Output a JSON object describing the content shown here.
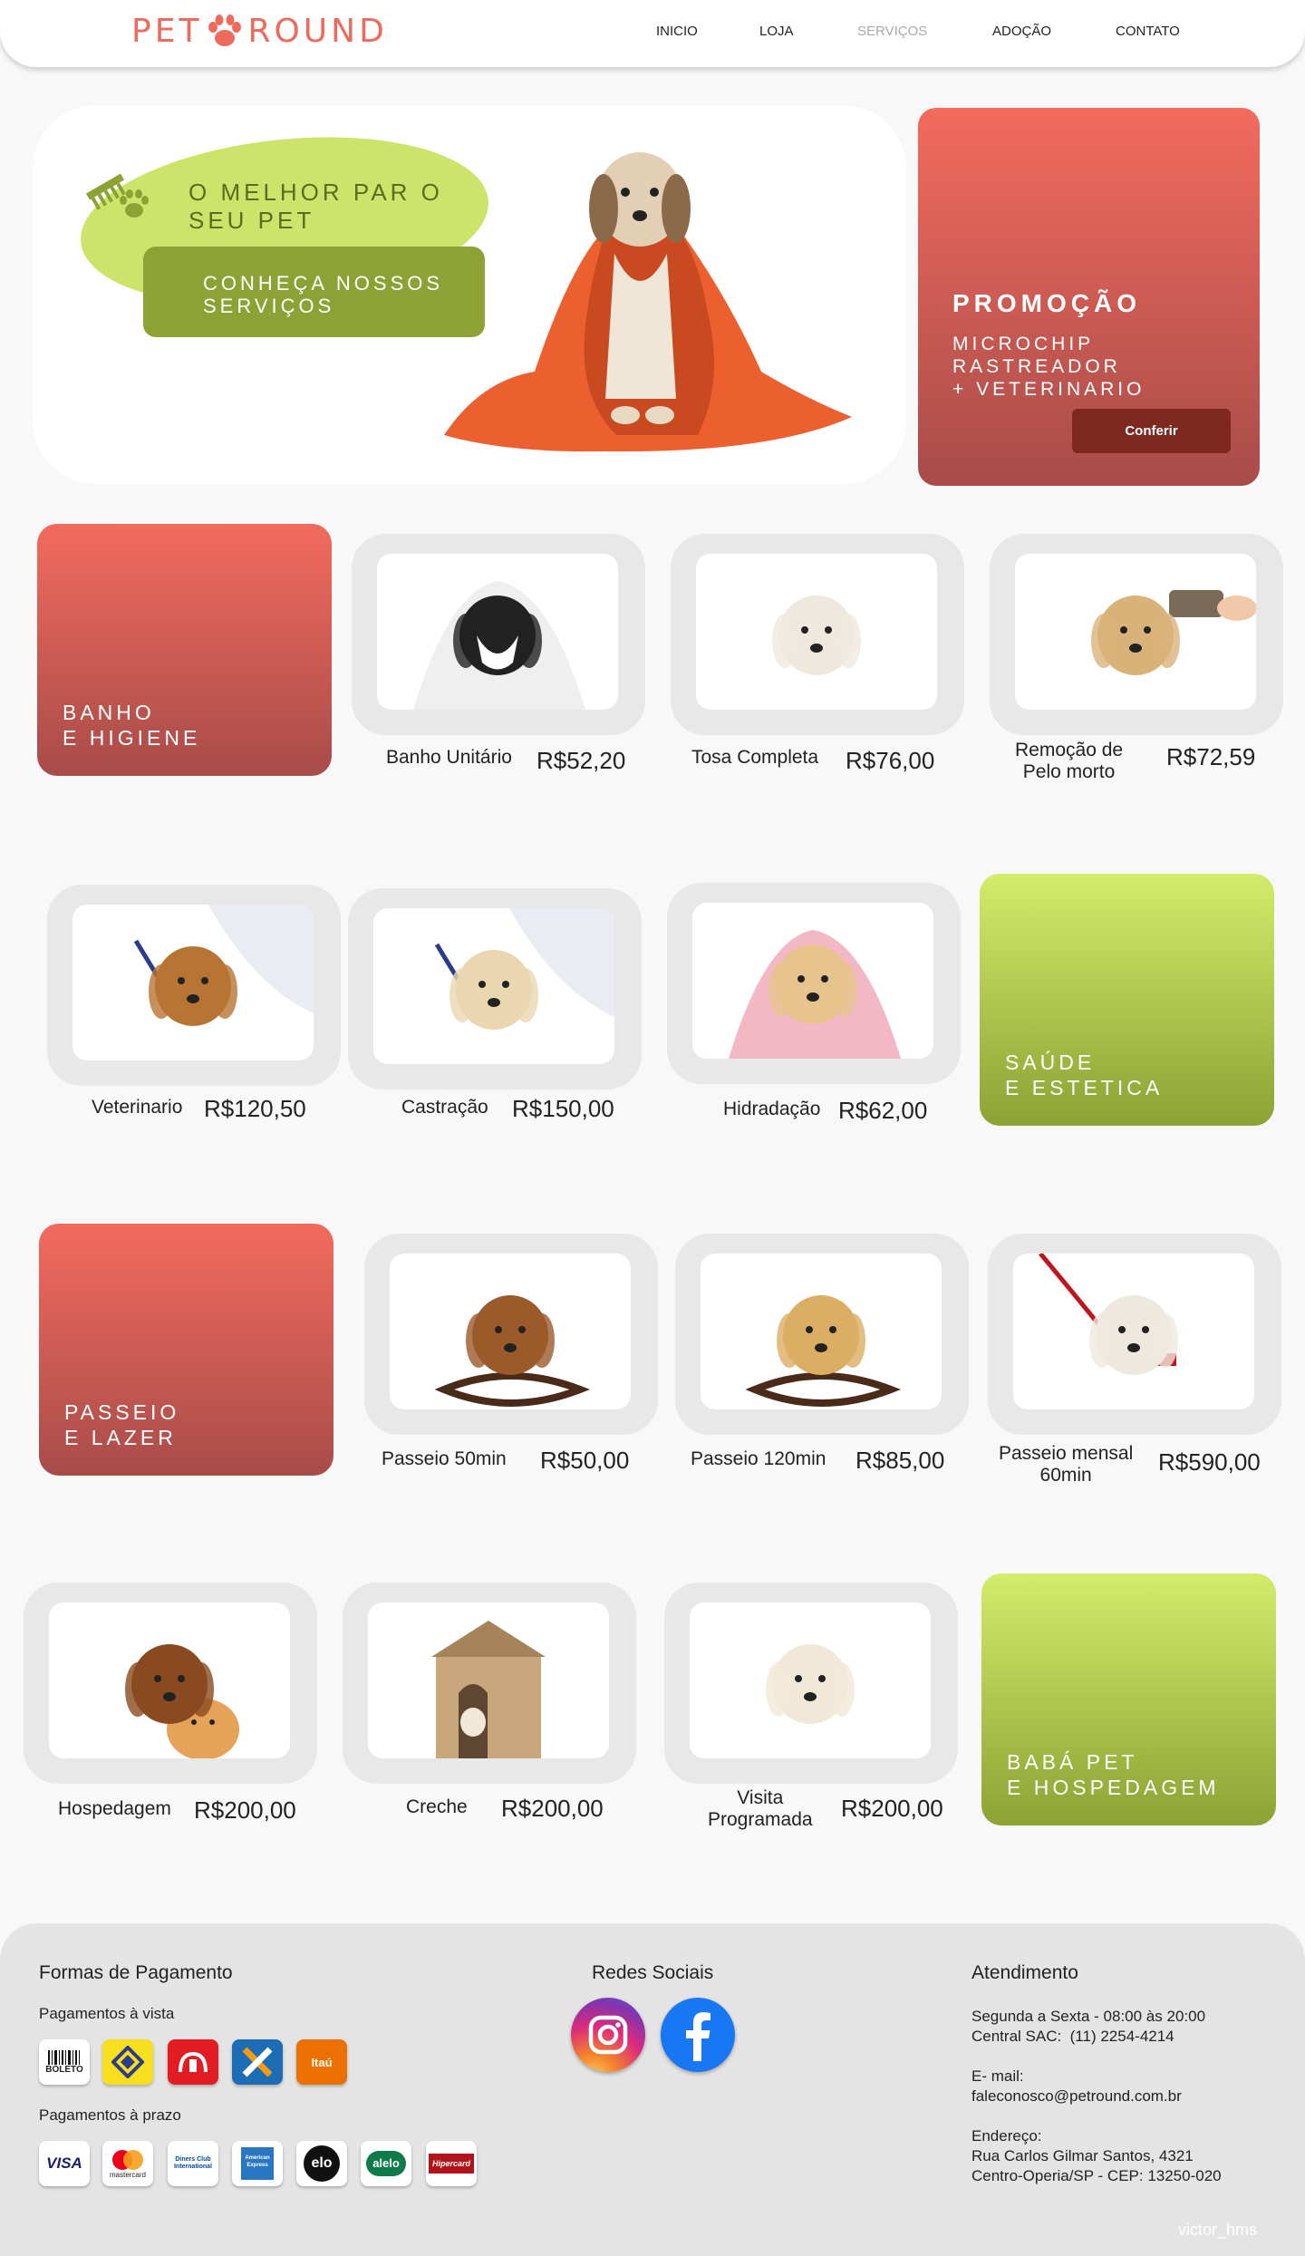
{
  "brand": {
    "left": "PET",
    "right": "ROUND"
  },
  "nav": [
    {
      "label": "INICIO",
      "active": false
    },
    {
      "label": "LOJA",
      "active": false
    },
    {
      "label": "SERVIÇOS",
      "active": true
    },
    {
      "label": "ADOÇÃO",
      "active": false
    },
    {
      "label": "CONTATO",
      "active": false
    }
  ],
  "hero": {
    "title_line1": "O MELHOR PAR O",
    "title_line2": "SEU PET",
    "button_line1": "CONHEÇA NOSSOS",
    "button_line2": "SERVIÇOS"
  },
  "promo": {
    "title": "PROMOÇÃO",
    "line1": "MICROCHIP",
    "line2": "RASTREADOR",
    "line3": "+ VETERINARIO",
    "button": "Conferir"
  },
  "categories": [
    {
      "line1": "BANHO",
      "line2": "E HIGIENE",
      "color": "red"
    },
    {
      "line1": "SAÚDE",
      "line2": "E ESTETICA",
      "color": "green"
    },
    {
      "line1": "PASSEIO",
      "line2": "E LAZER",
      "color": "red"
    },
    {
      "line1": "BABÁ PET",
      "line2": "E HOSPEDAGEM",
      "color": "green"
    }
  ],
  "services": [
    {
      "name1": "Banho Unitário",
      "name2": "",
      "price": "R$52,20",
      "image": "dog-in-towel"
    },
    {
      "name1": "Tosa Completa",
      "name2": "",
      "price": "R$76,00",
      "image": "groomed-white-dog"
    },
    {
      "name1": "Remoção de",
      "name2": "Pelo morto",
      "price": "R$72,59",
      "image": "dog-being-brushed"
    },
    {
      "name1": "Veterinario",
      "name2": "",
      "price": "R$120,50",
      "image": "vet-with-beagle"
    },
    {
      "name1": "Castração",
      "name2": "",
      "price": "R$150,00",
      "image": "vet-with-labrador"
    },
    {
      "name1": "Hidradação",
      "name2": "",
      "price": "R$62,00",
      "image": "chihuahua-in-towel"
    },
    {
      "name1": "Passeio 50min",
      "name2": "",
      "price": "R$50,00",
      "image": "dog-holding-leash"
    },
    {
      "name1": "Passeio 120min",
      "name2": "",
      "price": "R$85,00",
      "image": "labrador-with-leash"
    },
    {
      "name1": "Passeio mensal",
      "name2": "60min",
      "price": "R$590,00",
      "image": "bulldog-in-harness"
    },
    {
      "name1": "Hospedagem",
      "name2": "",
      "price": "R$200,00",
      "image": "dog-and-cat"
    },
    {
      "name1": "Creche",
      "name2": "",
      "price": "R$200,00",
      "image": "dog-house"
    },
    {
      "name1": "Visita",
      "name2": "Programada",
      "price": "R$200,00",
      "image": "lying-labrador"
    }
  ],
  "footer": {
    "payments_title": "Formas de Pagamento",
    "cash_title": "Pagamentos à vista",
    "cash_methods": [
      "BOLETO",
      "Banco do Brasil",
      "Bradesco",
      "Caixa",
      "Itaú"
    ],
    "credit_title": "Pagamentos à prazo",
    "credit_methods": [
      "VISA",
      "mastercard",
      "Diners Club International",
      "American Express",
      "elo",
      "alelo",
      "Hipercard"
    ],
    "social_title": "Redes Sociais",
    "social": [
      "instagram-icon",
      "facebook-icon"
    ],
    "support_title": "Atendimento",
    "hours": "Segunda a Sexta - 08:00 às 20:00",
    "phone": "Central SAC:  (11) 2254-4214",
    "email_label": "E- mail:",
    "email": "faleconosco@petround.com.br",
    "address_label": "Endereço:",
    "address1": "Rua Carlos Gilmar Santos, 4321",
    "address2": "Centro-Operia/SP - CEP: 13250-020"
  },
  "credit": "victor_hms",
  "colors": {
    "accent": "#ee6a5c",
    "green": "#8da234",
    "light_green": "#cde46a",
    "dark_red": "#7f2820"
  }
}
